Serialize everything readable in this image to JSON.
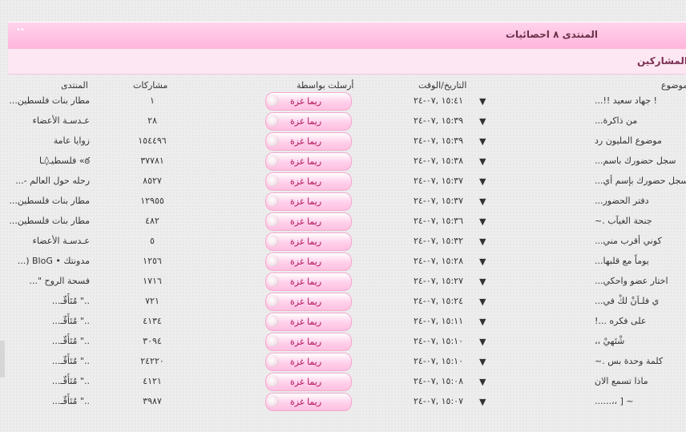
{
  "header": {
    "title": "المنتدى ٨ احصائيات",
    "dots": "••"
  },
  "subheader": {
    "label": "أكثر المشاركين"
  },
  "columns": {
    "topic": "الموضوع",
    "datetime": "التاريخ/الوقت",
    "sent_by": "أرسلت بواسطة",
    "posts": "مشاركات",
    "forum": "المنتدى"
  },
  "rows": [
    {
      "topic": "! جهاد سعيد !!...",
      "date": "١٥:٤١ ,٠٧-٢٤",
      "poster": "ريما غزة",
      "posts": "١",
      "forum": "مطار بنات فلسطين..."
    },
    {
      "topic": "من ذاكرة...",
      "date": "١٥:٣٩ ,٠٧-٢٤",
      "poster": "ريما غزة",
      "posts": "٢٨",
      "forum": "عـدسـة الأعضاء"
    },
    {
      "topic": "موضوع المليون رد",
      "date": "١٥:٣٩ ,٠٧-٢٤",
      "poster": "ريما غزة",
      "posts": "١٥٤٤٩٦",
      "forum": "زوايا عامة"
    },
    {
      "topic": "سجل حضورك باسم...",
      "date": "١٥:٣٨ ,٠٧-٢٤",
      "poster": "ريما غزة",
      "posts": "٣٧٧٨١",
      "forum": "ఠ» فلسطيـ◊ـا"
    },
    {
      "topic": "سجل حضورك بإسم أي...",
      "date": "١٥:٣٧ ,٠٧-٢٤",
      "poster": "ريما غزة",
      "posts": "٨٥٢٧",
      "forum": "رحله حول العالم -..."
    },
    {
      "topic": "دفتر الحضور...",
      "date": "١٥:٣٧ ,٠٧-٢٤",
      "poster": "ريما غزة",
      "posts": "١٢٩٥٥",
      "forum": "مطار بنات فلسطين..."
    },
    {
      "topic": "جنحة الغيآب .~",
      "date": "١٥:٣٦ ,٠٧-٢٤",
      "poster": "ريما غزة",
      "posts": "٤٨٢",
      "forum": "مطار بنات فلسطين..."
    },
    {
      "topic": "كوني أقرب مني...",
      "date": "١٥:٣٢ ,٠٧-٢٤",
      "poster": "ريما غزة",
      "posts": "٥",
      "forum": "عـدسـة الأعضاء"
    },
    {
      "topic": "يوماً مع قلبها...",
      "date": "١٥:٢٨ ,٠٧-٢٤",
      "poster": "ريما غزة",
      "posts": "١٢٥٦",
      "forum": "مدونتك • BloG (..."
    },
    {
      "topic": "اختار عضو واحكي...",
      "date": "١٥:٢٧ ,٠٧-٢٤",
      "poster": "ريما غزة",
      "posts": "١٧١٦",
      "forum": "فسحة الروح \"..."
    },
    {
      "topic": "ي فلـاَنْ لكْ في...",
      "date": "١٥:٢٤ ,٠٧-٢٤",
      "poster": "ريما غزة",
      "posts": "٧٢١",
      "forum": "..\" مٌتَأَقّـ..."
    },
    {
      "topic": "على فكره ...!",
      "date": "١٥:١١ ,٠٧-٢٤",
      "poster": "ريما غزة",
      "posts": "٤١٣٤",
      "forum": "..\" مٌتَأَقّـ..."
    },
    {
      "topic": "شْتَهيْ ،،",
      "date": "١٥:١٠ ,٠٧-٢٤",
      "poster": "ريما غزة",
      "posts": "٣٠٩٤",
      "forum": "..\" مٌتَأَقّـ..."
    },
    {
      "topic": "كلمة وحدة بس .~",
      "date": "١٥:١٠ ,٠٧-٢٤",
      "poster": "ريما غزة",
      "posts": "٢٤٢٢٠",
      "forum": "..\" مٌتَأَقّـ..."
    },
    {
      "topic": "ماذا تسمع الان",
      "date": "١٥:٠٨ ,٠٧-٢٤",
      "poster": "ريما غزة",
      "posts": "٤١٢١",
      "forum": "..\" مٌتَأَقّـ..."
    },
    {
      "topic": "~ [ ،،......",
      "date": "١٥:٠٧ ,٠٧-٢٤",
      "poster": "ريما غزة",
      "posts": "٣٩٨٧",
      "forum": "..\" مٌتَأَقّـ..."
    }
  ],
  "colors": {
    "accent": "#ffb5dc",
    "title_text": "#6b3048",
    "poster_text": "#b1125a"
  },
  "icons": {
    "row_arrow": "triangle-down-icon",
    "poster_badge": "ball-icon"
  }
}
